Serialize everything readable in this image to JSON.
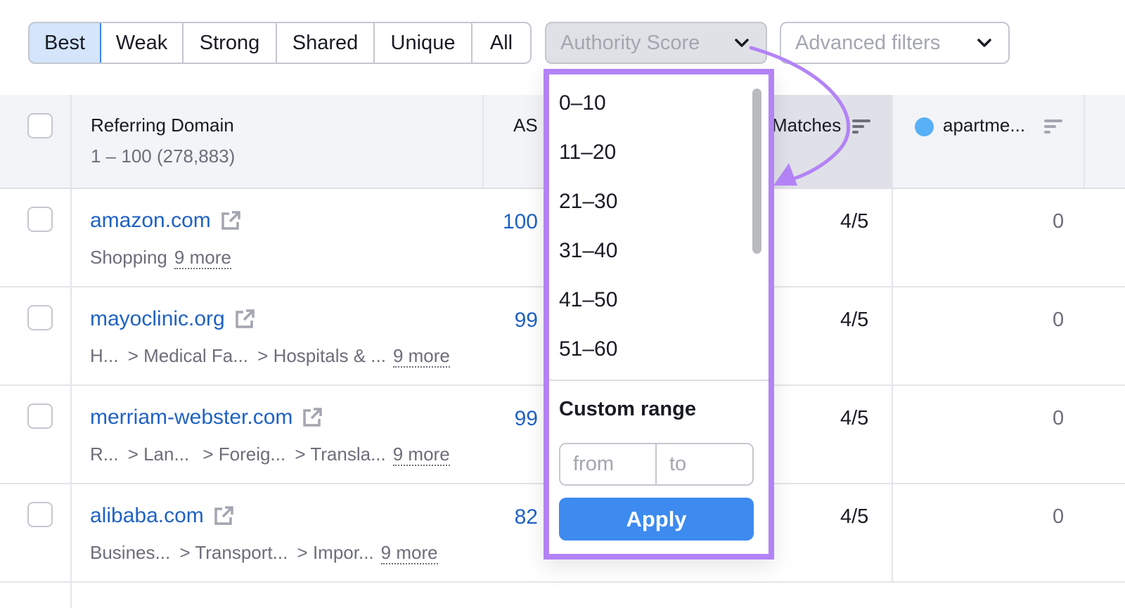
{
  "tabs": [
    {
      "label": "Best",
      "active": true
    },
    {
      "label": "Weak",
      "active": false
    },
    {
      "label": "Strong",
      "active": false
    },
    {
      "label": "Shared",
      "active": false
    },
    {
      "label": "Unique",
      "active": false
    },
    {
      "label": "All",
      "active": false
    }
  ],
  "filters": {
    "authority_score": {
      "label": "Authority Score",
      "icon": "chevron-down-icon",
      "open": true
    },
    "advanced": {
      "label": "Advanced filters",
      "icon": "chevron-down-icon"
    }
  },
  "table": {
    "headers": {
      "referring_domain": "Referring Domain",
      "range_count": "1 – 100 (278,883)",
      "as": "AS",
      "matches": "Matches",
      "competitor": "apartme...",
      "competitor_color": "#58b0f6"
    },
    "rows": [
      {
        "domain": "amazon.com",
        "categories": [
          "Shopping"
        ],
        "more": "9 more",
        "as": "100",
        "matches": "4/5",
        "competitor": "0"
      },
      {
        "domain": "mayoclinic.org",
        "categories": [
          "H...",
          "> Medical Fa...",
          "> Hospitals & ..."
        ],
        "more": "9 more",
        "as": "99",
        "matches": "4/5",
        "competitor": "0"
      },
      {
        "domain": "merriam-webster.com",
        "categories": [
          "R...",
          "> Lan...",
          "> Foreig...",
          "> Transla..."
        ],
        "more": "9 more",
        "as": "99",
        "matches": "4/5",
        "competitor": "0"
      },
      {
        "domain": "alibaba.com",
        "categories": [
          "Busines...",
          "> Transport...",
          "> Impor..."
        ],
        "more": "9 more",
        "as": "82",
        "matches": "4/5",
        "competitor": "0"
      }
    ]
  },
  "dropdown": {
    "options": [
      "0–10",
      "11–20",
      "21–30",
      "31–40",
      "41–50",
      "51–60"
    ],
    "custom_range_title": "Custom range",
    "from_placeholder": "from",
    "to_placeholder": "to",
    "from_value": "",
    "to_value": "",
    "apply_label": "Apply",
    "highlight_color": "#b383f6"
  }
}
